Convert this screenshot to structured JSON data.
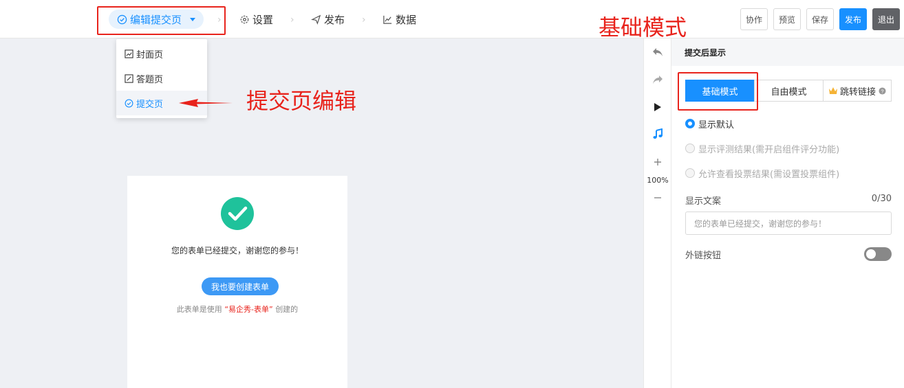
{
  "nav": {
    "edit_label": "编辑提交页",
    "settings_label": "设置",
    "publish_label": "发布",
    "data_label": "数据"
  },
  "toolbar": {
    "collab": "协作",
    "preview": "预览",
    "save": "保存",
    "publish": "发布",
    "exit": "退出"
  },
  "dropdown": {
    "items": [
      {
        "label": "封面页"
      },
      {
        "label": "答题页"
      },
      {
        "label": "提交页"
      }
    ]
  },
  "annotations": {
    "basic_mode": "基础模式",
    "submit_edit": "提交页编辑"
  },
  "card": {
    "message": "您的表单已经提交，谢谢您的参与！",
    "button": "我也要创建表单",
    "footer_prefix": "此表单是使用",
    "footer_brand": "“易企秀-表单”",
    "footer_suffix": "创建的"
  },
  "vtools": {
    "zoom": "100%"
  },
  "panel": {
    "title": "提交后显示",
    "modes": [
      "基础模式",
      "自由模式",
      "跳转链接"
    ],
    "options": [
      {
        "label": "显示默认",
        "checked": true,
        "disabled": false
      },
      {
        "label": "显示评测结果(需开启组件评分功能)",
        "checked": false,
        "disabled": true
      },
      {
        "label": "允许查看投票结果(需设置投票组件)",
        "checked": false,
        "disabled": true
      }
    ],
    "copy_label": "显示文案",
    "copy_counter": "0/30",
    "copy_placeholder": "您的表单已经提交，谢谢您的参与！",
    "link_button_label": "外链按钮",
    "link_button_on": false
  },
  "colors": {
    "accent": "#1890ff",
    "annotation": "#e8231c",
    "success": "#1fc29b"
  }
}
